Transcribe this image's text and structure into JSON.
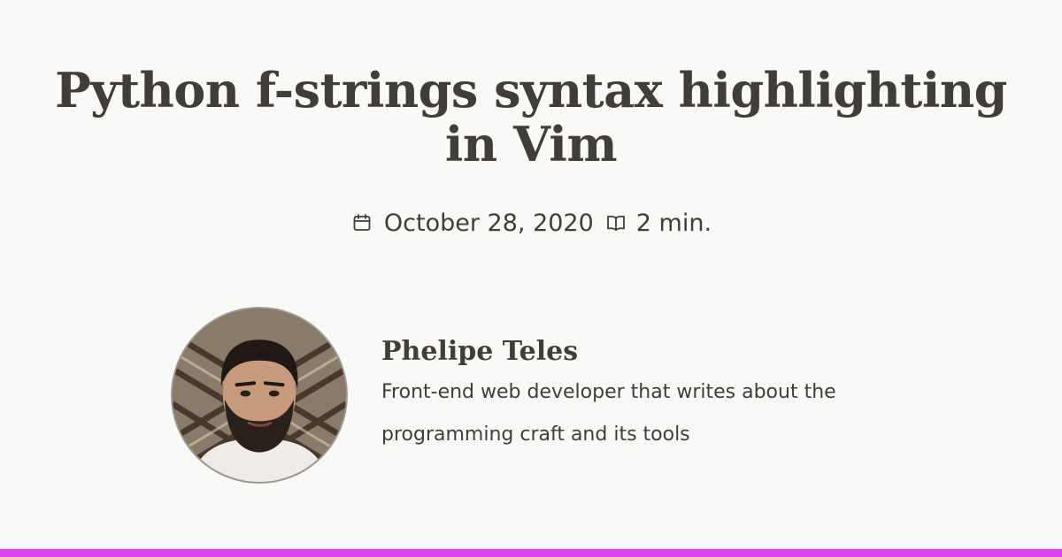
{
  "post": {
    "title": "Python f-strings syntax highlighting in Vim",
    "date": "October 28, 2020",
    "reading_time": "2 min."
  },
  "author": {
    "name": "Phelipe Teles",
    "bio": "Front-end web developer that writes about the programming craft and its tools",
    "avatar_icon": "author-photo"
  },
  "icons": {
    "date": "calendar-icon",
    "reading_time": "open-book-icon"
  },
  "colors": {
    "background": "#f9f9f8",
    "text": "#403d3a",
    "accent": "#d946ef"
  }
}
